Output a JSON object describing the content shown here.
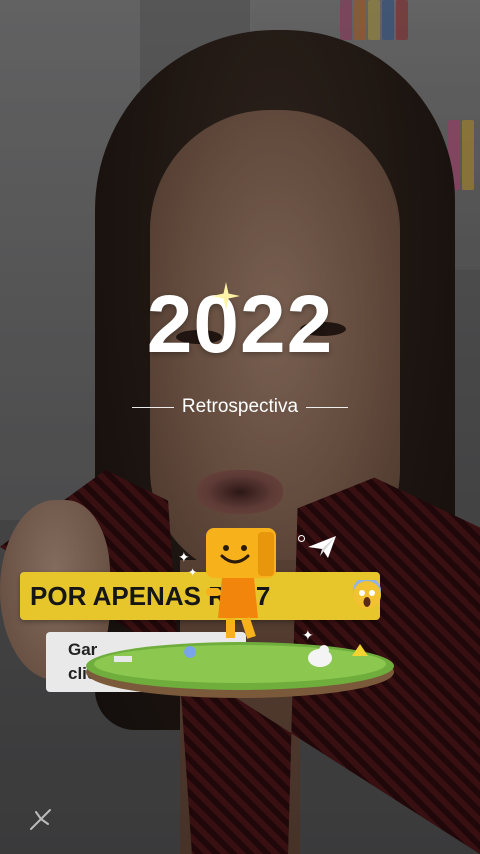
{
  "overlay": {
    "year": "2022",
    "subtitle": "Retrospectiva"
  },
  "caption": {
    "main_text": "POR APENAS R$87",
    "emoji": "😱"
  },
  "subcaption": {
    "line1": "Gar",
    "line2": "clica"
  },
  "icons": {
    "sparkle": "sparkle-icon",
    "mascot": "smiley-box-mascot",
    "plane": "paper-plane-icon",
    "island": "grass-island-sticker",
    "corner": "pin-icon"
  },
  "colors": {
    "caption_bg": "#e6c62a",
    "caption_text": "#161616",
    "mascot": "#f2a40c"
  }
}
